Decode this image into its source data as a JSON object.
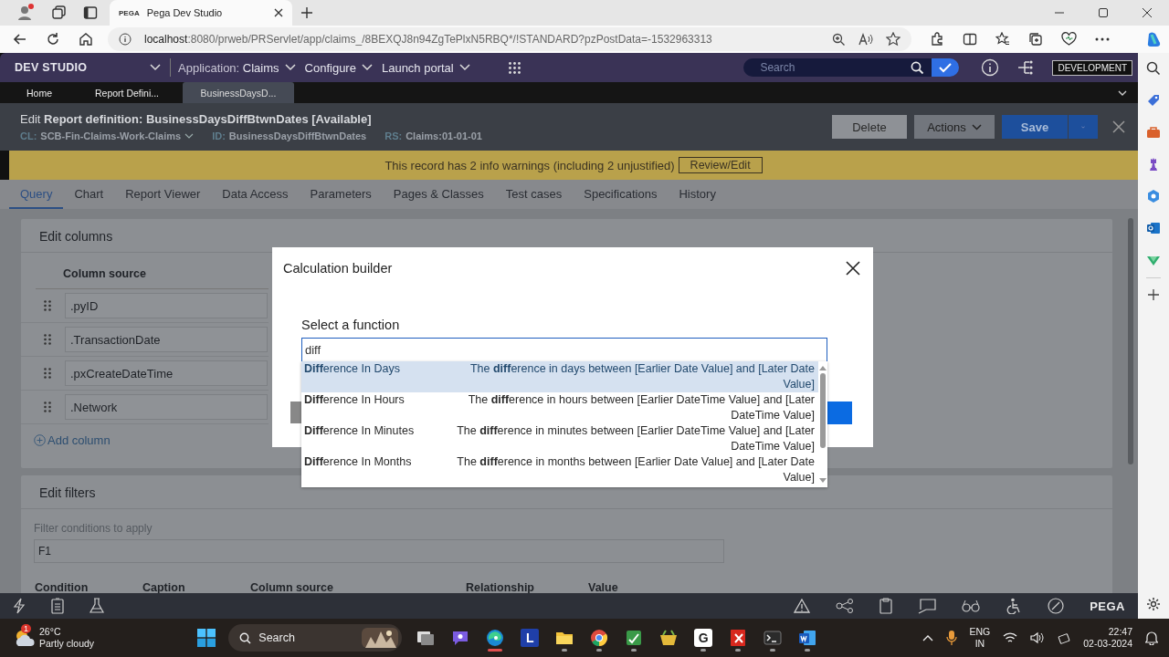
{
  "browser": {
    "favicon_text": "PEGA",
    "tab_title": "Pega Dev Studio",
    "url_host": "localhost",
    "url_rest": ":8080/prweb/PRServlet/app/claims_/8BEXQJ8n94ZgTePlxN5RBQ*/!STANDARD?pzPostData=-1532963313"
  },
  "studio": {
    "name": "DEV STUDIO",
    "application_label": "Application:",
    "application": "Claims",
    "menus": [
      "Configure",
      "Launch portal"
    ],
    "search_placeholder": "Search",
    "environment": "DEVELOPMENT"
  },
  "doc_tabs": [
    {
      "label": "Home",
      "selected": false
    },
    {
      "label": "Report Defini...",
      "selected": false
    },
    {
      "label": "BusinessDaysD...",
      "selected": true
    }
  ],
  "record": {
    "action": "Edit",
    "title": "Report definition: BusinessDaysDiffBtwnDates [Available]",
    "cl_label": "CL:",
    "cl": "SCB-Fin-Claims-Work-Claims",
    "id_label": "ID:",
    "id": "BusinessDaysDiffBtwnDates",
    "rs_label": "RS:",
    "rs": "Claims:01-01-01",
    "delete": "Delete",
    "actions": "Actions",
    "save": "Save"
  },
  "warning": {
    "message": "This record has 2 info warnings (including 2 unjustified)",
    "link": "Review/Edit"
  },
  "rule_tabs": [
    {
      "label": "Query",
      "selected": true
    },
    {
      "label": "Chart",
      "selected": false
    },
    {
      "label": "Report Viewer",
      "selected": false
    },
    {
      "label": "Data Access",
      "selected": false
    },
    {
      "label": "Parameters",
      "selected": false
    },
    {
      "label": "Pages & Classes",
      "selected": false
    },
    {
      "label": "Test cases",
      "selected": false
    },
    {
      "label": "Specifications",
      "selected": false
    },
    {
      "label": "History",
      "selected": false
    }
  ],
  "edit_columns": {
    "title": "Edit columns",
    "header": "Column source",
    "rows": [
      ".pyID",
      ".TransactionDate",
      ".pxCreateDateTime",
      ".Network"
    ],
    "add": "Add column"
  },
  "edit_filters": {
    "title": "Edit filters",
    "conditions_label": "Filter conditions to apply",
    "conditions_value": "F1",
    "columns": [
      "Condition",
      "Caption",
      "Column source",
      "Relationship",
      "Value"
    ]
  },
  "dialog": {
    "title": "Calculation builder",
    "label": "Select a function",
    "value": "diff",
    "options": [
      {
        "name": "**Diff**erence In Days",
        "description": "The **diff**erence in days between [Earlier Date Value] and [Later Date Value]",
        "selected": true
      },
      {
        "name": "**Diff**erence In Hours",
        "description": "The **diff**erence in hours between [Earlier DateTime Value] and [Later DateTime Value]",
        "selected": false
      },
      {
        "name": "**Diff**erence In Minutes",
        "description": "The **diff**erence in minutes between [Earlier DateTime Value] and [Later DateTime Value]",
        "selected": false
      },
      {
        "name": "**Diff**erence In Months",
        "description": "The **diff**erence in months between [Earlier Date Value] and [Later Date Value]",
        "selected": false
      }
    ]
  },
  "bottom_bar": {
    "brand": "PEGA"
  },
  "taskbar": {
    "weather_badge": "1",
    "temperature": "26°C",
    "weather": "Partly cloudy",
    "search": "Search",
    "apps": [
      {
        "kind": "taskview",
        "running": false,
        "selected": false
      },
      {
        "kind": "chat",
        "running": false,
        "selected": false
      },
      {
        "kind": "edge",
        "running": true,
        "selected": true
      },
      {
        "kind": "letter",
        "label": "L",
        "running": false,
        "selected": false
      },
      {
        "kind": "folder",
        "running": true,
        "selected": false
      },
      {
        "kind": "chrome",
        "running": true,
        "selected": false
      },
      {
        "kind": "sheet",
        "running": true,
        "selected": false
      },
      {
        "kind": "basket",
        "running": false,
        "selected": false
      },
      {
        "kind": "gletter",
        "label": "G",
        "running": true,
        "selected": false
      },
      {
        "kind": "pdf",
        "running": true,
        "selected": false
      },
      {
        "kind": "terminal",
        "running": true,
        "selected": false
      },
      {
        "kind": "word",
        "running": true,
        "selected": false
      }
    ],
    "language": "ENG",
    "region": "IN",
    "time": "22:47",
    "date": "02-03-2024"
  }
}
